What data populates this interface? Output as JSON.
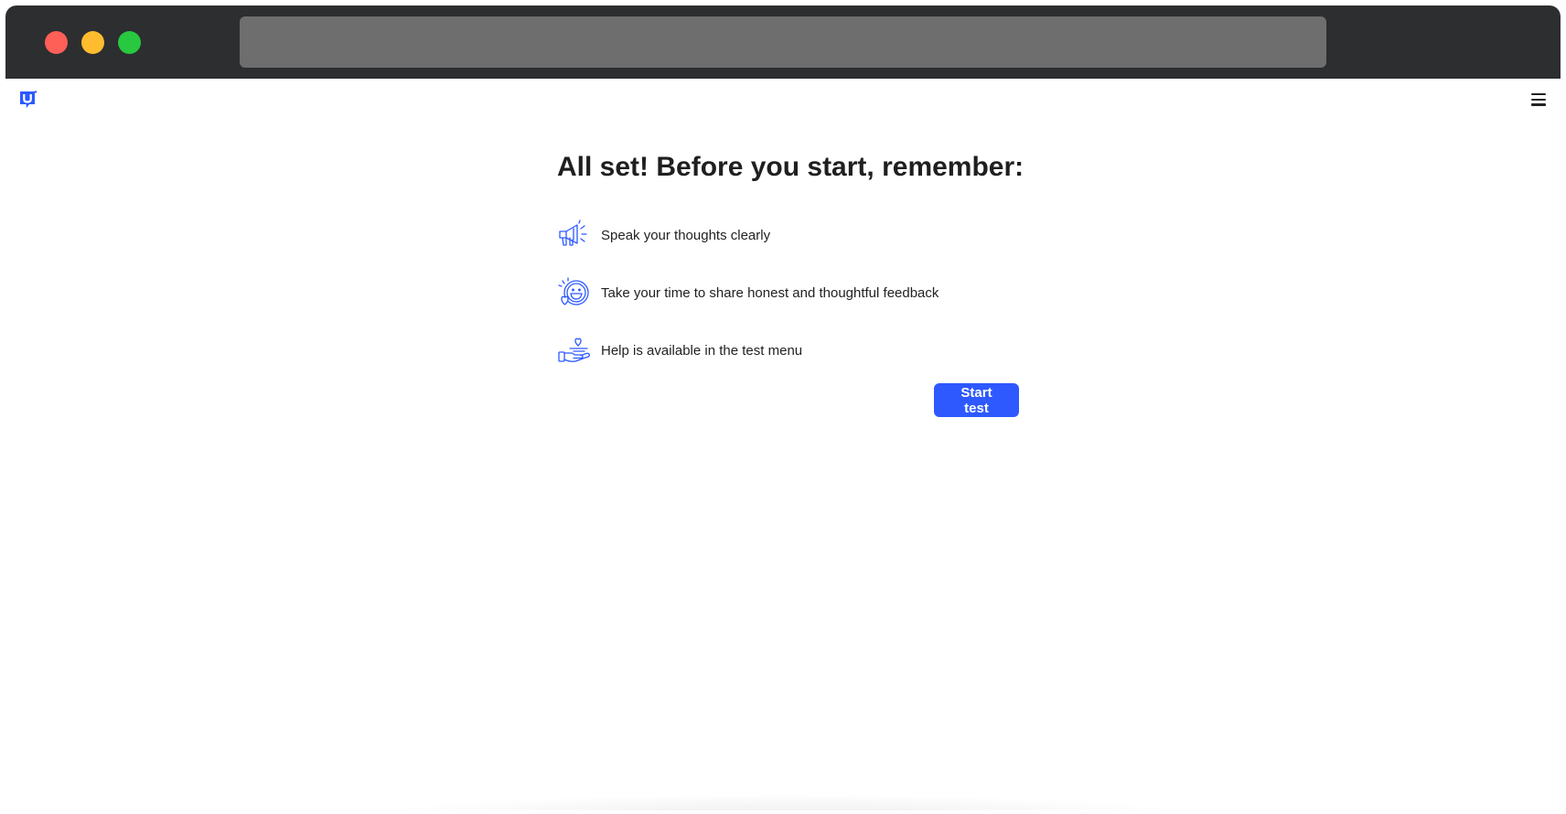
{
  "page": {
    "heading": "All set! Before you start, remember:",
    "items": [
      {
        "icon": "megaphone-icon",
        "label": "Speak your thoughts clearly"
      },
      {
        "icon": "smiley-heart-icon",
        "label": "Take your time to share honest and thoughtful feedback"
      },
      {
        "icon": "hand-heart-icon",
        "label": "Help is available in the test menu"
      }
    ],
    "start_button": "Start test"
  },
  "header": {
    "logo": "U",
    "menu_icon": "hamburger-menu-icon"
  },
  "colors": {
    "accent": "#2d59ff",
    "titlebar": "#2d2e30",
    "urlbar": "#6e6e6e"
  }
}
